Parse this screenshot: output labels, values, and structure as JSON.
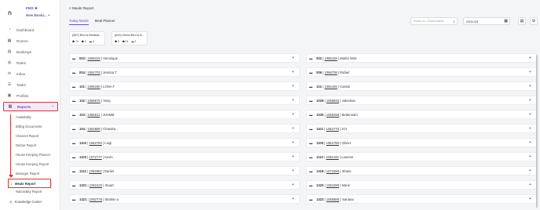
{
  "brand": {
    "logo": "ก",
    "line1": "PMS",
    "line2": "New Booki..."
  },
  "nav": [
    {
      "label": "Dashboard",
      "icon": "dashboard-icon",
      "glyph": "◔"
    },
    {
      "label": "Rooms",
      "icon": "rooms-icon",
      "glyph": "▦"
    },
    {
      "label": "Bookings",
      "icon": "bookings-icon",
      "glyph": "▤"
    },
    {
      "label": "Rates",
      "icon": "rates-icon",
      "glyph": "◍"
    },
    {
      "label": "Inbox",
      "icon": "inbox-icon",
      "glyph": "✉"
    },
    {
      "label": "Tasks",
      "icon": "tasks-icon",
      "glyph": "☰"
    },
    {
      "label": "Profiles",
      "icon": "profiles-icon",
      "glyph": "▣"
    },
    {
      "label": "Reports",
      "icon": "reports-icon",
      "glyph": "▥"
    }
  ],
  "reports_sub": [
    "Availability",
    "Billing Documents",
    "Channel Report",
    "Debtor Report",
    "House Keeping Planner",
    "House Keeping Report",
    "Manager Report",
    "Meals Report",
    "Nationality Report"
  ],
  "footer": {
    "label": "Knowledge Center"
  },
  "main": {
    "back": "< Meals Report",
    "tabs": [
      "Today Meals",
      "Meal Planner"
    ],
    "search_placeholder": "Room nr / Guest name",
    "date": "29/11/23"
  },
  "summary": [
    {
      "title": "(687) Bed & Breakfa...",
      "counts": [
        "74",
        "0",
        "4"
      ]
    },
    {
      "title": "(690) Direct Bed & B...",
      "counts": [
        "3",
        "11",
        "1"
      ]
    }
  ],
  "rooms_left": [
    {
      "room": "003",
      "booking": "1068419",
      "guest": "Veronique"
    },
    {
      "room": "004",
      "booking": "1062703",
      "guest": "Jessica T"
    },
    {
      "room": "101",
      "booking": "1065180",
      "guest": "LONA F"
    },
    {
      "room": "102",
      "booking": "1068675",
      "guest": "Yang"
    },
    {
      "room": "103",
      "booking": "1065511",
      "guest": "JUHMB"
    },
    {
      "room": "104",
      "booking": "1062889",
      "guest": "Chandra..."
    },
    {
      "room": "1102",
      "booking": "1062793",
      "guest": "Luigi"
    },
    {
      "room": "1103",
      "booking": "1072777",
      "guest": "Kevin"
    },
    {
      "room": "1112",
      "booking": "1062863",
      "guest": "Daniel"
    },
    {
      "room": "1201",
      "booking": "1062432",
      "guest": "Stuart"
    },
    {
      "room": "1421",
      "booking": "1062775",
      "guest": "Ibrahim a"
    }
  ],
  "rooms_right": [
    {
      "room": "002",
      "booking": "1065428",
      "guest": "Martin Wint"
    },
    {
      "room": "006",
      "booking": "1066708",
      "guest": "Rafael"
    },
    {
      "room": "101",
      "booking": "1062446",
      "guest": "Cassie"
    },
    {
      "room": "1029",
      "booking": "1068832",
      "guest": "Valentina"
    },
    {
      "room": "1030",
      "booking": "1065258",
      "guest": "Bettennam"
    },
    {
      "room": "1101",
      "booking": "1062779",
      "guest": "JOI"
    },
    {
      "room": "1105",
      "booking": "1062768",
      "guest": "Olivier"
    },
    {
      "room": "1110",
      "booking": "1062443",
      "guest": "Laurens"
    },
    {
      "room": "1318",
      "booking": "1071550",
      "guest": "Shane"
    },
    {
      "room": "1320",
      "booking": "1061590",
      "guest": "Marie"
    },
    {
      "room": "1423",
      "booking": "1065885",
      "guest": "mariana"
    }
  ]
}
